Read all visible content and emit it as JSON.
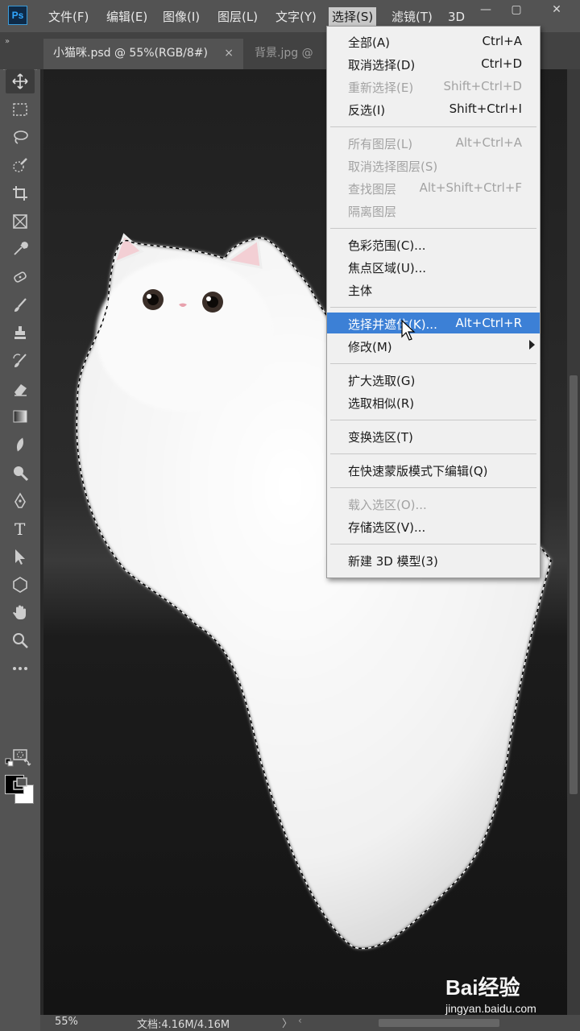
{
  "app": {
    "logo_text": "Ps"
  },
  "menubar": {
    "items": [
      {
        "label": "文件(F)"
      },
      {
        "label": "编辑(E)"
      },
      {
        "label": "图像(I)"
      },
      {
        "label": "图层(L)"
      },
      {
        "label": "文字(Y)"
      },
      {
        "label": "选择(S)",
        "active": true
      },
      {
        "label": "滤镜(T)"
      },
      {
        "label": "3D"
      }
    ],
    "window_controls": {
      "minimize": "—",
      "maximize": "▢",
      "close": "✕"
    }
  },
  "tabs": [
    {
      "label": "小猫咪.psd @ 55%(RGB/8#)",
      "close": "×",
      "active": true
    },
    {
      "label": "背景.jpg @",
      "active": false
    }
  ],
  "toolbar": {
    "collapse_glyph": "»",
    "tools": [
      {
        "icon": "move-icon",
        "selected": true
      },
      {
        "icon": "rectangular-marquee-icon"
      },
      {
        "icon": "lasso-icon"
      },
      {
        "icon": "quick-selection-icon"
      },
      {
        "icon": "crop-icon"
      },
      {
        "icon": "frame-icon"
      },
      {
        "icon": "eyedropper-icon"
      },
      {
        "icon": "healing-brush-icon"
      },
      {
        "icon": "brush-icon"
      },
      {
        "icon": "clone-stamp-icon"
      },
      {
        "icon": "history-brush-icon"
      },
      {
        "icon": "eraser-icon"
      },
      {
        "icon": "gradient-icon"
      },
      {
        "icon": "blur-icon"
      },
      {
        "icon": "dodge-icon"
      },
      {
        "icon": "pen-icon"
      },
      {
        "icon": "type-icon"
      },
      {
        "icon": "path-selection-icon"
      },
      {
        "icon": "shape-icon"
      },
      {
        "icon": "hand-icon"
      },
      {
        "icon": "zoom-icon"
      },
      {
        "icon": "more-tools-icon"
      }
    ],
    "foreground_color": "#000000",
    "background_color": "#ffffff",
    "type_tool_glyph": "T",
    "more_glyph": "•••"
  },
  "select_menu": {
    "groups": [
      [
        {
          "label": "全部(A)",
          "shortcut": "Ctrl+A",
          "disabled": false
        },
        {
          "label": "取消选择(D)",
          "shortcut": "Ctrl+D",
          "disabled": false
        },
        {
          "label": "重新选择(E)",
          "shortcut": "Shift+Ctrl+D",
          "disabled": true
        },
        {
          "label": "反选(I)",
          "shortcut": "Shift+Ctrl+I",
          "disabled": false
        }
      ],
      [
        {
          "label": "所有图层(L)",
          "shortcut": "Alt+Ctrl+A",
          "disabled": true
        },
        {
          "label": "取消选择图层(S)",
          "shortcut": "",
          "disabled": true
        },
        {
          "label": "查找图层",
          "shortcut": "Alt+Shift+Ctrl+F",
          "disabled": true
        },
        {
          "label": "隔离图层",
          "shortcut": "",
          "disabled": true
        }
      ],
      [
        {
          "label": "色彩范围(C)...",
          "shortcut": "",
          "disabled": false
        },
        {
          "label": "焦点区域(U)...",
          "shortcut": "",
          "disabled": false
        },
        {
          "label": "主体",
          "shortcut": "",
          "disabled": false
        }
      ],
      [
        {
          "label": "选择并遮住(K)...",
          "shortcut": "Alt+Ctrl+R",
          "disabled": false,
          "highlighted": true
        },
        {
          "label": "修改(M)",
          "shortcut": "",
          "disabled": false,
          "submenu": true
        }
      ],
      [
        {
          "label": "扩大选取(G)",
          "shortcut": "",
          "disabled": false
        },
        {
          "label": "选取相似(R)",
          "shortcut": "",
          "disabled": false
        }
      ],
      [
        {
          "label": "变换选区(T)",
          "shortcut": "",
          "disabled": false
        }
      ],
      [
        {
          "label": "在快速蒙版模式下编辑(Q)",
          "shortcut": "",
          "disabled": false
        }
      ],
      [
        {
          "label": "载入选区(O)...",
          "shortcut": "",
          "disabled": true
        },
        {
          "label": "存储选区(V)...",
          "shortcut": "",
          "disabled": false
        }
      ],
      [
        {
          "label": "新建 3D 模型(3)",
          "shortcut": "",
          "disabled": false
        }
      ]
    ],
    "highlight_color": "#3c80d6"
  },
  "statusbar": {
    "zoom": "55%",
    "doc_info": "文档:4.16M/4.16M",
    "arrow": "〉",
    "scroll_left": "‹"
  },
  "watermark": {
    "logo_text": "Bai经验",
    "url": "jingyan.baidu.com"
  }
}
